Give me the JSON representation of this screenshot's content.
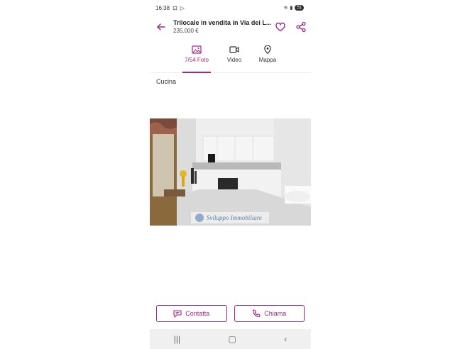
{
  "status": {
    "time": "16:38",
    "battery": "51"
  },
  "header": {
    "title": "Trilocale in vendita in Via dei L...",
    "price": "235.000 €"
  },
  "tabs": [
    {
      "label": "7/54 Foto",
      "icon": "photo-icon",
      "active": true
    },
    {
      "label": "Video",
      "icon": "video-icon",
      "active": false
    },
    {
      "label": "Mappa",
      "icon": "map-pin-icon",
      "active": false
    }
  ],
  "photo": {
    "caption": "Cucina",
    "watermark": "Sviluppo Immobiliare"
  },
  "actions": {
    "contact": "Contatta",
    "call": "Chiama"
  },
  "colors": {
    "accent": "#a1268a"
  }
}
